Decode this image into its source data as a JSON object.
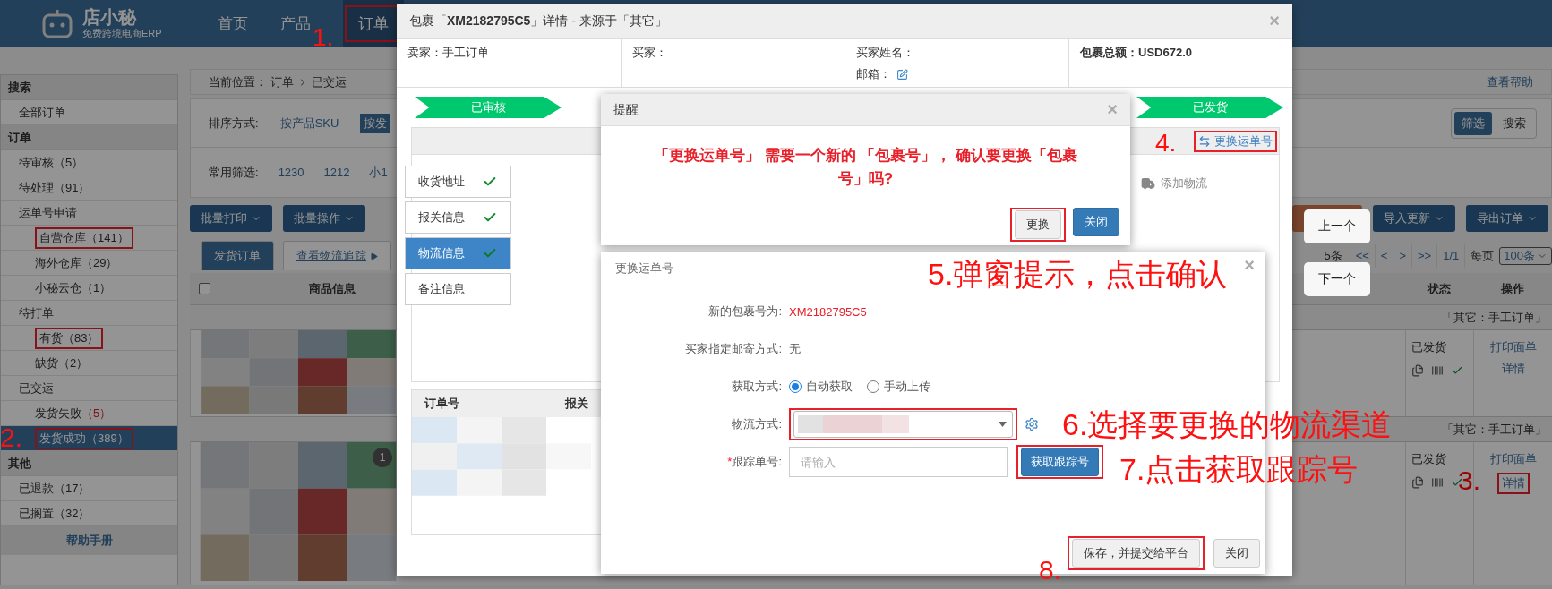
{
  "header": {
    "logo": {
      "name": "店小秘",
      "tagline": "免费跨境电商ERP"
    },
    "nav": [
      {
        "label": "首页",
        "selected": false,
        "outlined": false
      },
      {
        "label": "产品",
        "selected": false,
        "outlined": false
      },
      {
        "label": "订单",
        "selected": true,
        "outlined": true
      }
    ]
  },
  "sidebar": {
    "sections": [
      {
        "title": "搜索",
        "items": [
          {
            "label": "全部订单",
            "selected": false
          }
        ]
      },
      {
        "title": "订单",
        "items": [
          {
            "label": "待审核",
            "count": "（5）",
            "selected": false
          },
          {
            "label": "待处理",
            "count": "（91）",
            "selected": false
          },
          {
            "label": "运单号申请",
            "selected": false,
            "children": [
              {
                "label": "自营仓库",
                "count": "（141）",
                "selected": false,
                "outlined": true
              },
              {
                "label": "海外仓库",
                "count": "（29）",
                "selected": false
              },
              {
                "label": "小秘云仓",
                "count": "（1）",
                "selected": false
              }
            ]
          },
          {
            "label": "待打单",
            "selected": false,
            "children": [
              {
                "label": "有货",
                "count": "（83）",
                "selected": false,
                "outlined": true
              },
              {
                "label": "缺货",
                "count": "（2）",
                "selected": false
              }
            ]
          },
          {
            "label": "已交运",
            "selected": false,
            "children": [
              {
                "label": "发货失败",
                "count": "（5）",
                "count_alert": true,
                "selected": false
              },
              {
                "label": "发货成功",
                "count": "（389）",
                "selected": true,
                "outlined": true
              }
            ]
          }
        ]
      },
      {
        "title": "其他",
        "items": [
          {
            "label": "已退款",
            "count": "（17）",
            "selected": false
          },
          {
            "label": "已搁置",
            "count": "（32）",
            "selected": false
          }
        ]
      }
    ],
    "help": "帮助手册"
  },
  "main": {
    "breadcrumb": {
      "label": "当前位置：",
      "path": [
        "订单",
        "已交运"
      ]
    },
    "help_link": "查看帮助",
    "sort": {
      "label": "排序方式:",
      "options": [
        {
          "label": "按产品SKU",
          "selected": false
        },
        {
          "label": "按发",
          "selected": true
        }
      ]
    },
    "view_toggle": [
      {
        "label": "筛选",
        "selected": true
      },
      {
        "label": "搜索",
        "selected": false
      }
    ],
    "filters": {
      "label": "常用筛选:",
      "options": [
        "1230",
        "1212",
        "小1"
      ]
    },
    "bulk_buttons": [
      "批量打印",
      "批量操作"
    ],
    "right_buttons": [
      "导入更新",
      "导出订单"
    ],
    "tabs": [
      {
        "label": "发货订单",
        "selected": true
      },
      {
        "label": "查看物流追踪",
        "selected": false
      }
    ],
    "pagination": {
      "total": "5条",
      "first": "<<",
      "prev": "<",
      "next": ">",
      "last": ">>",
      "page": "1/1",
      "per_page_label": "每页",
      "per_page": "100条"
    },
    "table": {
      "select_all": {
        "checked": false
      },
      "columns": [
        "商品信息",
        "状态",
        "操作"
      ],
      "rows": [
        {
          "group": "「其它：手工订单」",
          "status": "已发货",
          "actions": [
            {
              "label": "打印面单",
              "outlined": false
            },
            {
              "label": "详情",
              "outlined": false
            }
          ]
        },
        {
          "group": "「其它：手工订单」",
          "status": "已发货",
          "actions": [
            {
              "label": "打印面单",
              "outlined": false
            },
            {
              "label": "详情",
              "outlined": true
            }
          ]
        }
      ]
    },
    "page_badge": "1"
  },
  "detail_dialog": {
    "title": "包裹「**XM2182795C5**」详情 - 来源于「其它」",
    "close": "×",
    "info": {
      "seller": "卖家：手工订单",
      "buyer": "买家：",
      "buyer_name": "买家姓名：",
      "email": "邮箱：",
      "total": "包裹总额：USD672.0"
    },
    "steps": [
      "已审核",
      "已发货"
    ],
    "change_link": {
      "label": "更换运单号",
      "outlined": true
    },
    "add_logistics": "添加物流",
    "side_tabs": [
      {
        "label": "收货地址",
        "done": true,
        "selected": false
      },
      {
        "label": "报关信息",
        "done": true,
        "selected": false
      },
      {
        "label": "物流信息",
        "done": true,
        "selected": true
      },
      {
        "label": "备注信息",
        "done": false,
        "selected": false
      }
    ],
    "order_table": {
      "columns": [
        "订单号",
        "报关"
      ]
    }
  },
  "reminder_dialog": {
    "title": "提醒",
    "close": "×",
    "message": "「更换运单号」 需要一个新的 「包裹号」， 确认要更换「包裹号」吗?",
    "buttons": [
      {
        "label": "更换",
        "primary": false,
        "outlined": true
      },
      {
        "label": "关闭",
        "primary": true,
        "outlined": false
      }
    ]
  },
  "change_dialog": {
    "title": "更换运单号",
    "close": "×",
    "new_number": {
      "label": "新的包裹号为:",
      "value": "XM2182795C5"
    },
    "buyer_method": {
      "label": "买家指定邮寄方式:",
      "value": "无"
    },
    "fetch_mode": {
      "label": "获取方式:",
      "options": [
        {
          "label": "自动获取",
          "selected": true
        },
        {
          "label": "手动上传",
          "selected": false
        }
      ]
    },
    "logistics": {
      "label": "物流方式:",
      "outlined": true
    },
    "tracking": {
      "label": "跟踪单号:",
      "required_mark": "*",
      "placeholder": "请输入",
      "button": "获取跟踪号",
      "button_outlined": true
    },
    "buttons": [
      {
        "label": "保存，并提交给平台",
        "outlined": true
      },
      {
        "label": "关闭",
        "outlined": false
      }
    ]
  },
  "nav_buttons": [
    "上一个",
    "下一个"
  ],
  "annotations": [
    {
      "text": "1."
    },
    {
      "text": "2."
    },
    {
      "text": "3."
    },
    {
      "text": "4."
    },
    {
      "text": "5.弹窗提示，点击确认"
    },
    {
      "text": "6.选择要更换的物流渠道"
    },
    {
      "text": "7.点击获取跟踪号"
    },
    {
      "text": "8."
    }
  ]
}
